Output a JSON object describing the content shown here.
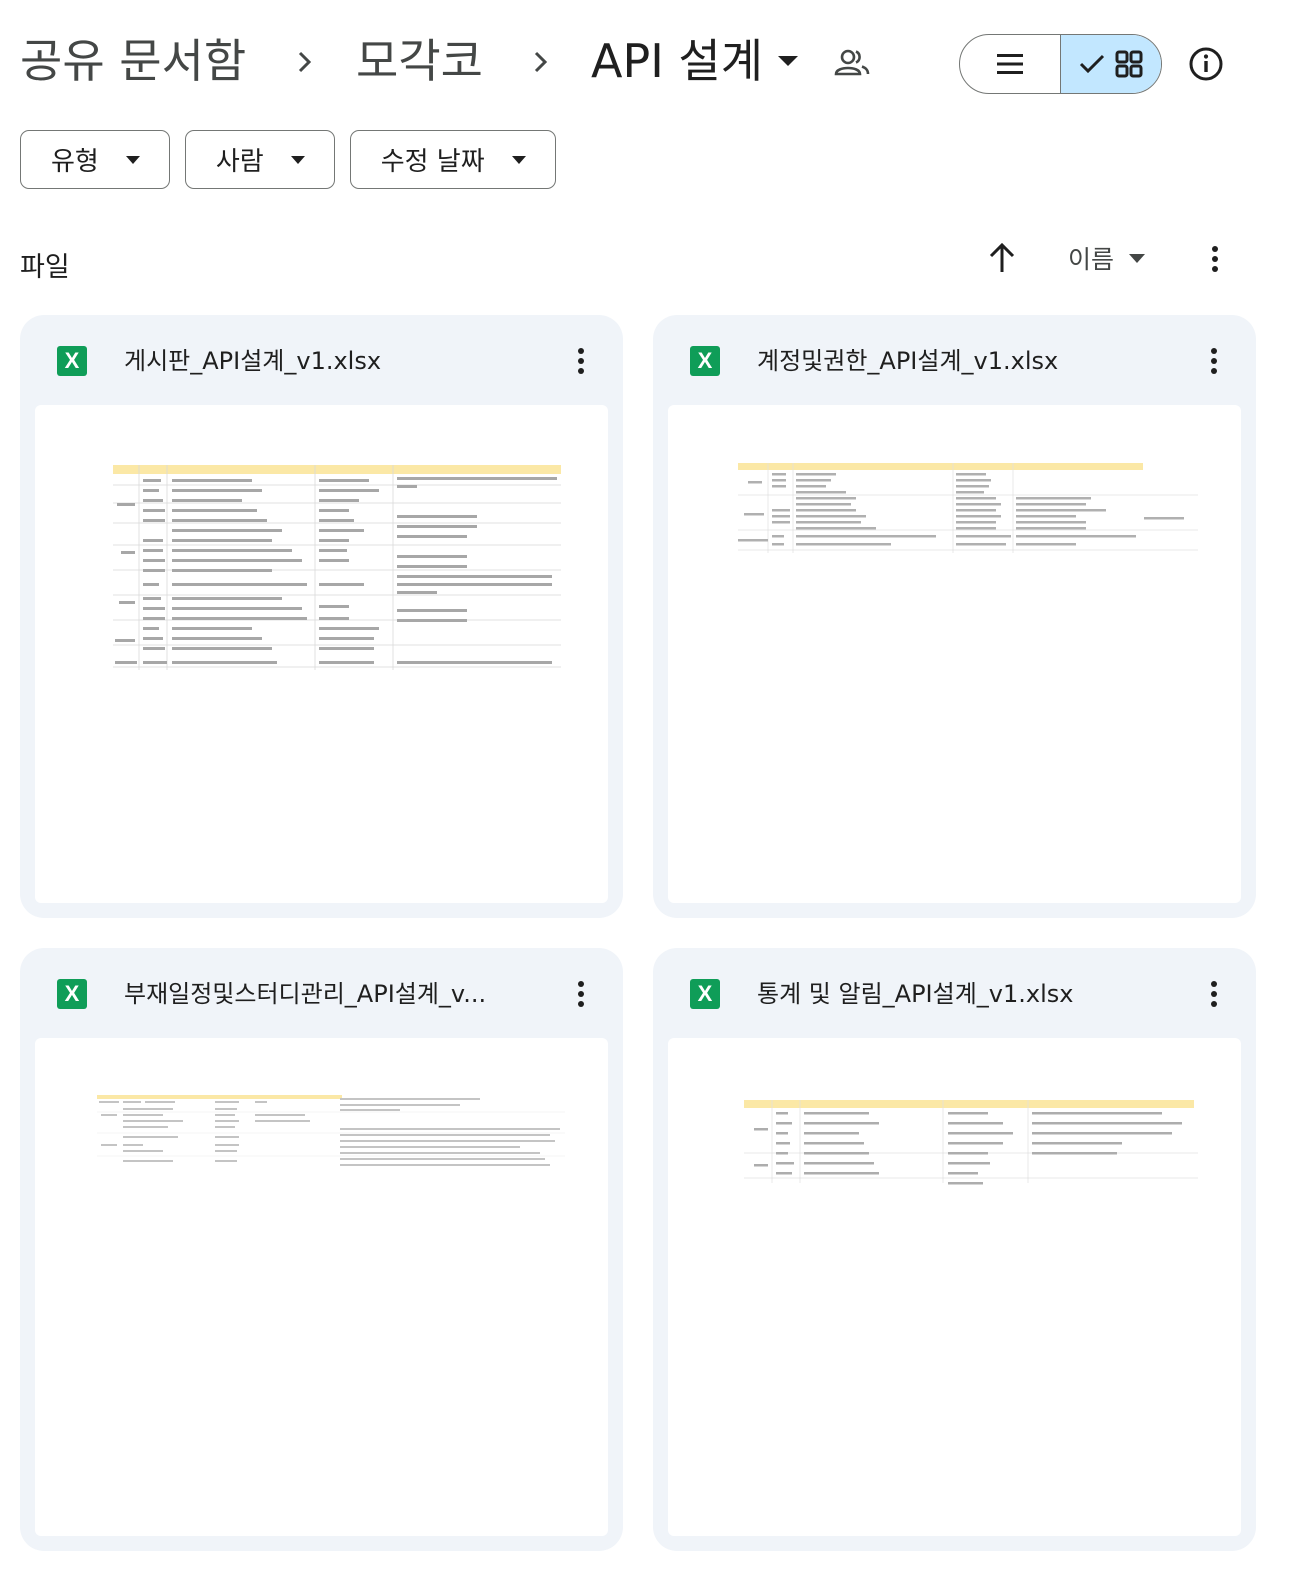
{
  "breadcrumb": {
    "root": "공유 문서함",
    "parent": "모각코",
    "current": "API 설계"
  },
  "header": {
    "shared_icon": "people-icon",
    "list_view_icon": "list-icon",
    "grid_view_icon": "grid-icon",
    "check_icon": "check-icon",
    "info_icon": "info-icon"
  },
  "filters": [
    {
      "label": "유형"
    },
    {
      "label": "사람"
    },
    {
      "label": "수정 날짜"
    }
  ],
  "section": {
    "title": "파일",
    "sort_label": "이름"
  },
  "files": [
    {
      "name": "게시판_API설계_v1.xlsx",
      "icon_label": "X"
    },
    {
      "name": "계정및권한_API설계_v1.xlsx",
      "icon_label": "X"
    },
    {
      "name": "부재일정및스터디관리_API설계_v...",
      "icon_label": "X"
    },
    {
      "name": "통계 및 알림_API설계_v1.xlsx",
      "icon_label": "X"
    }
  ],
  "colors": {
    "card_bg": "#f0f4f9",
    "active_toggle": "#c2e7ff",
    "excel_green": "#0f9d58",
    "sheet_header": "#fbe8a6"
  }
}
